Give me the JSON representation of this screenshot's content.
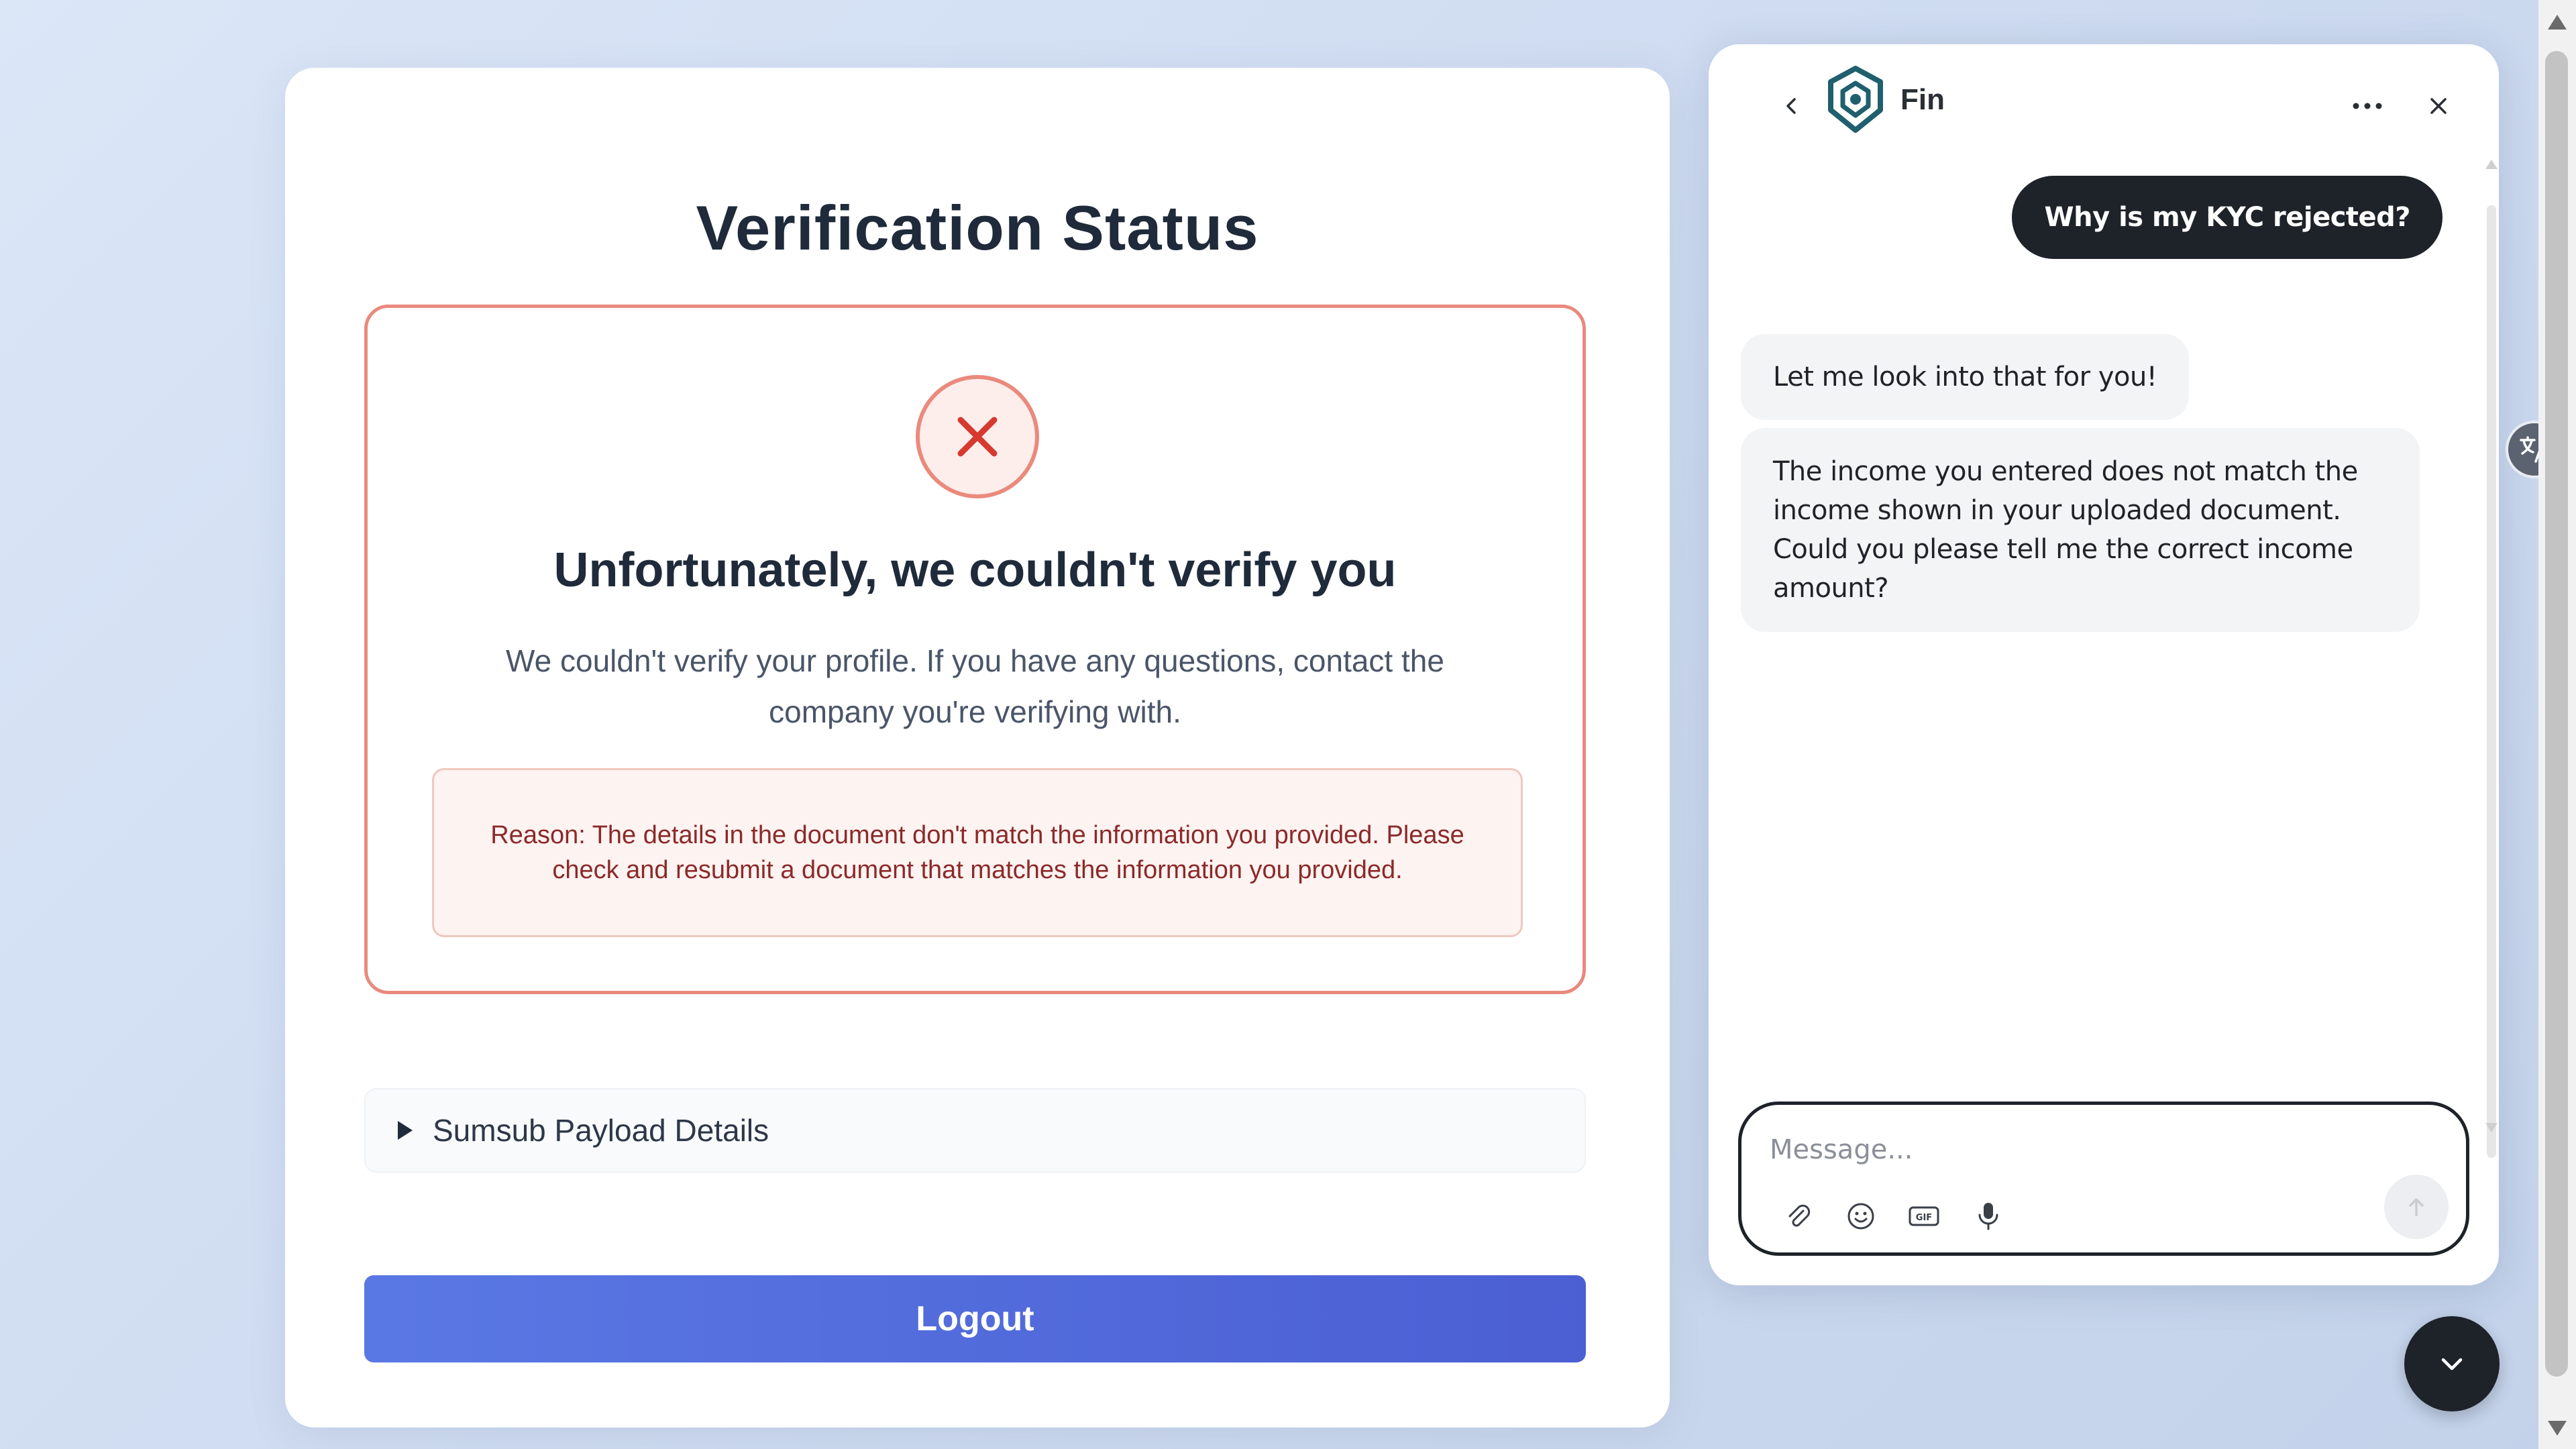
{
  "verification": {
    "title": "Verification Status",
    "status_heading": "Unfortunately, we couldn't verify you",
    "status_description": "We couldn't verify your profile. If you have any questions, contact the company you're verifying with.",
    "reason": "Reason: The details in the document don't match the information you provided. Please check and resubmit a document that matches the information you provided.",
    "status_icon": "x-mark-icon",
    "payload_details_label": "Sumsub Payload Details",
    "logout_label": "Logout"
  },
  "chat": {
    "agent_name": "Fin",
    "messages": [
      {
        "from": "user",
        "text": "Why is my KYC rejected?"
      },
      {
        "from": "bot",
        "text": "Let me look into that for you!"
      },
      {
        "from": "bot",
        "text": "The income you entered does not match the income shown in your uploaded document. Could you please tell me the correct income amount?"
      }
    ],
    "input_placeholder": "Message...",
    "composer_tools": [
      "paperclip-icon",
      "emoji-icon",
      "gif-icon",
      "microphone-icon"
    ]
  },
  "colors": {
    "error_accent": "#e9897e",
    "primary_button": "#5a78e4",
    "chat_dark": "#1e2229"
  }
}
